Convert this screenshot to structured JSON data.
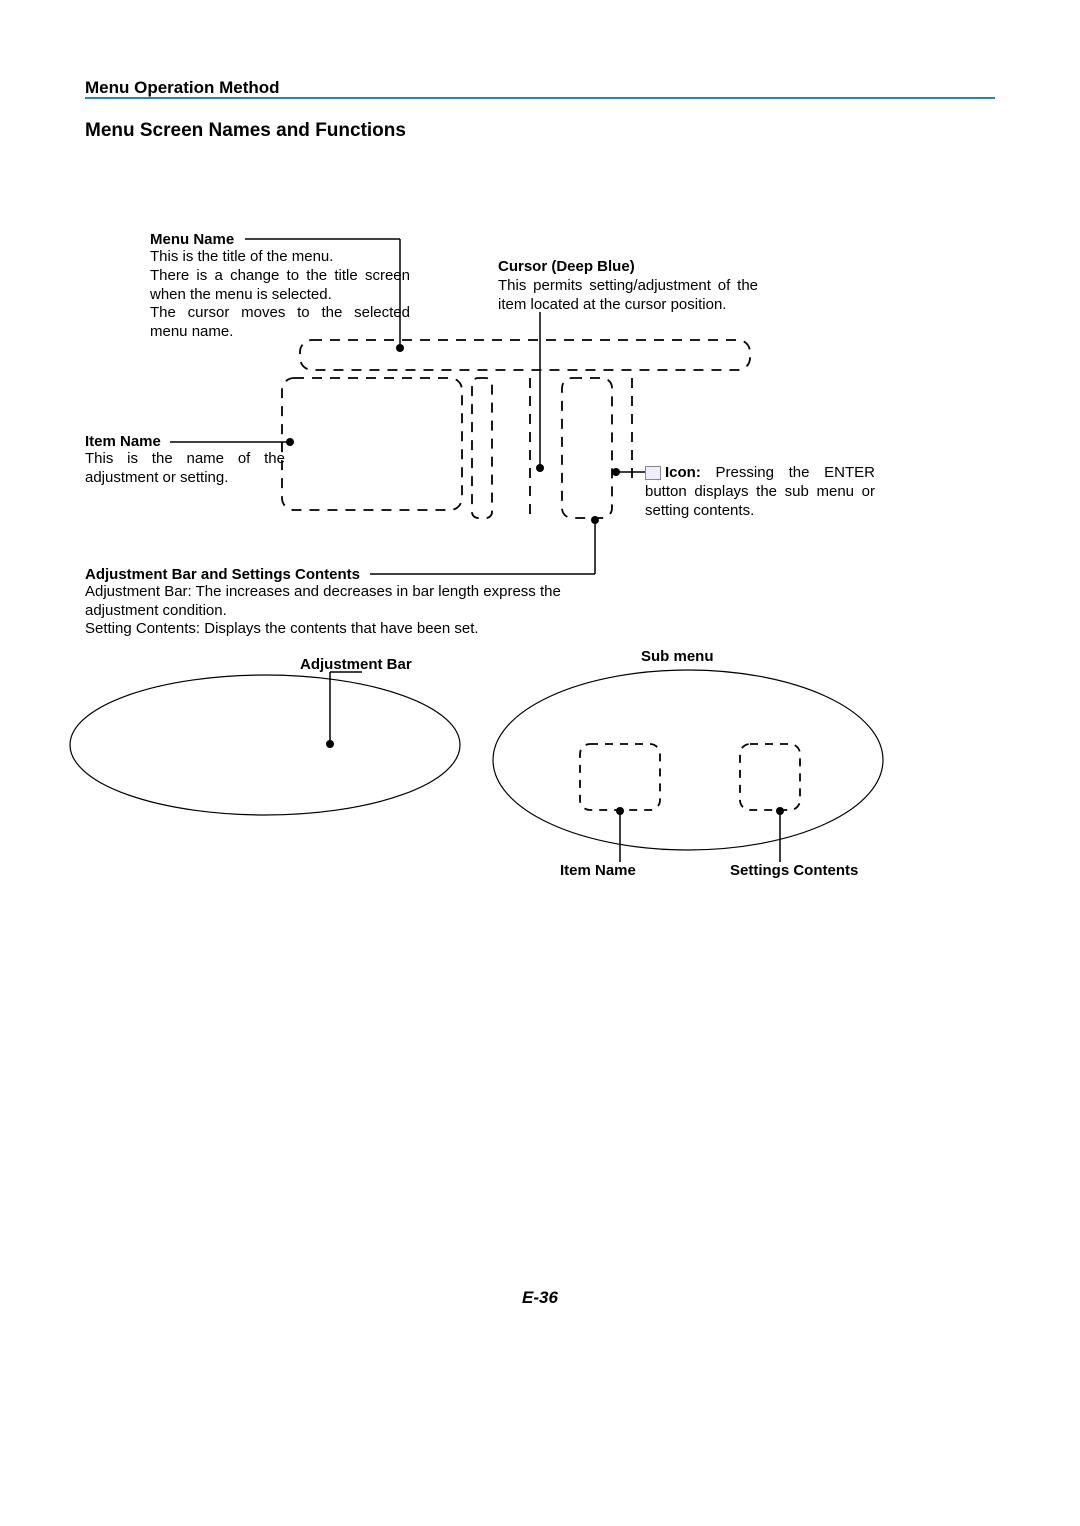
{
  "header": "Menu Operation Method",
  "section_title": "Menu Screen Names and Functions",
  "menu_name": {
    "title": "Menu Name",
    "body": "This is the title of the menu.\nThere is a change to the title screen when the menu is selected.\nThe cursor moves to the selected menu name."
  },
  "cursor": {
    "title": "Cursor (Deep Blue)",
    "body": "This permits setting/adjustment of the item located at the cursor position."
  },
  "item_name": {
    "title": "Item Name",
    "body": "This is the name of the adjustment or setting."
  },
  "icon": {
    "label": "Icon:",
    "body": "Pressing the ENTER button displays the sub menu or setting contents."
  },
  "adj_bar_section": {
    "title": "Adjustment Bar and Settings Contents",
    "line1": "Adjustment Bar: The increases and decreases in bar length express the adjustment condition.",
    "line2": "Setting Contents: Displays the contents that have been set."
  },
  "labels": {
    "adjustment_bar": "Adjustment Bar",
    "sub_menu": "Sub menu",
    "item_name_small": "Item Name",
    "settings_contents": "Settings Contents"
  },
  "page_number": "E-36"
}
